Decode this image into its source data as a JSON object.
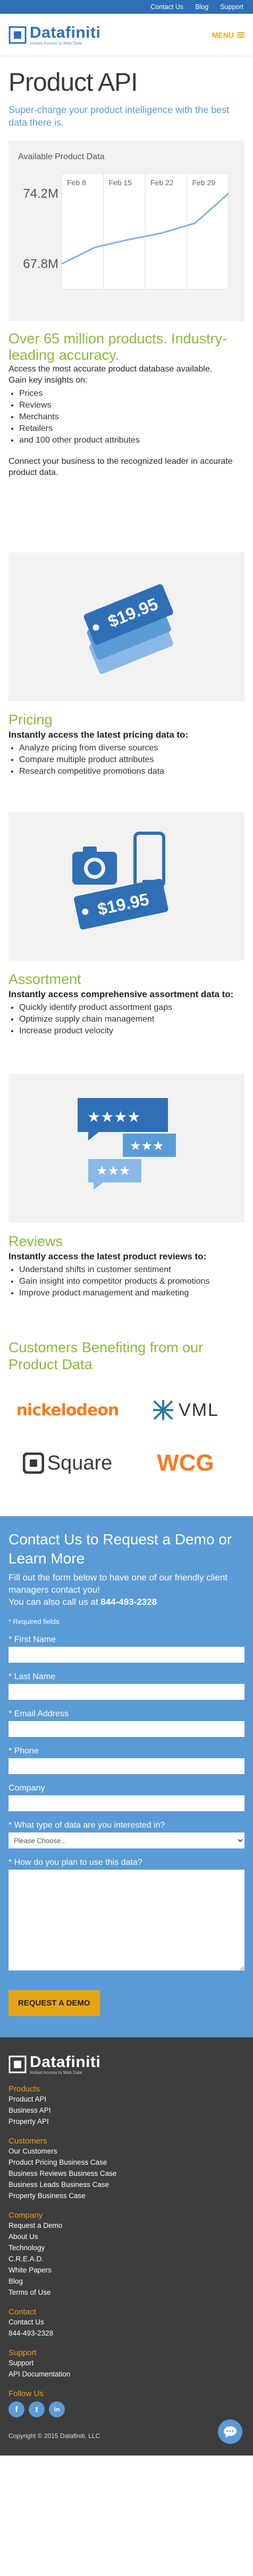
{
  "topnav": {
    "links": [
      "Contact Us",
      "Blog",
      "Support"
    ]
  },
  "header": {
    "logo_text": "Datafiniti",
    "logo_tag": "Instant Access to Web Data",
    "menu_label": "MENU"
  },
  "hero": {
    "title": "Product API",
    "subtitle": "Super-charge your product intelligence with the best data there is."
  },
  "chart_data": {
    "type": "line",
    "title": "Available Product Data",
    "categories": [
      "Feb 8",
      "Feb 15",
      "Feb 22",
      "Feb 29"
    ],
    "y_ticks": [
      "74.2M",
      "67.8M"
    ],
    "values": [
      67.8,
      69.3,
      70.0,
      70.6,
      71.5,
      74.2
    ],
    "ylim": [
      65.5,
      76.0
    ],
    "color": "#7fb1e3"
  },
  "intro": {
    "heading": "Over 65 million products. Industry-leading accuracy.",
    "lead": "Access the most accurate product database available.",
    "gain": "Gain key insights on:",
    "bullets": [
      "Prices",
      "Reviews",
      "Merchants",
      "Retailers",
      "and 100 other product attributes"
    ],
    "closing": "Connect your business to the recognized leader in accurate product data."
  },
  "pricing": {
    "heading": "Pricing",
    "sub": "Instantly access the latest pricing data to:",
    "bullets": [
      "Analyze pricing from diverse sources",
      "Compare multiple product attributes",
      "Research competitive promotions data"
    ],
    "tag_price": "$19.95"
  },
  "assortment": {
    "heading": "Assortment",
    "sub": "Instantly access comprehensive assortment data to:",
    "bullets": [
      "Quickly identify product assortment gaps",
      "Optimize supply chain management",
      "Increase product velocity"
    ],
    "tag_price": "$19.95"
  },
  "reviews": {
    "heading": "Reviews",
    "sub": "Instantly access the latest product reviews to:",
    "bullets": [
      "Understand shifts in customer sentiment",
      "Gain insight into competitor products & promotions",
      "Improve product management and marketing"
    ]
  },
  "customers": {
    "heading": "Customers Benefiting from our Product Data",
    "logos": [
      "nickelodeon",
      "VML",
      "Square",
      "WCG"
    ]
  },
  "contact": {
    "heading": "Contact Us to Request a Demo or Learn More",
    "text": "Fill out the form below to have one of our friendly client managers contact you!",
    "call_prefix": "You can also call us at",
    "phone": "844-493-2328",
    "required_note": "* Required fields",
    "fields": {
      "first_name": "* First Name",
      "last_name": "* Last Name",
      "email": "* Email Address",
      "phone": "* Phone",
      "company": "Company",
      "data_type": "* What type of data are you interested in?",
      "data_type_selected": "Please Choose...",
      "usage": "* How do you plan to use this data?"
    },
    "submit": "REQUEST A DEMO"
  },
  "footer": {
    "logo_text": "Datafiniti",
    "logo_tag": "Instant Access to Web Data",
    "products_h": "Products",
    "products": [
      "Product API",
      "Business API",
      "Property API"
    ],
    "customers_h": "Customers",
    "customers": [
      "Our Customers",
      "Product Pricing Business Case",
      "Business Reviews Business Case",
      "Business Leads Business Case",
      "Property Business Case"
    ],
    "company_h": "Company",
    "company": [
      "Request a Demo",
      "About Us",
      "Technology",
      "C.R.E.A.D.",
      "White Papers",
      "Blog",
      "Terms of Use"
    ],
    "contact_h": "Contact",
    "contact": [
      "Contact Us",
      "844-493-2328"
    ],
    "support_h": "Support",
    "support": [
      "Support",
      "API Documentation"
    ],
    "follow_h": "Follow Us",
    "social": [
      "f",
      "t",
      "in"
    ],
    "copyright": "Copyright © 2015 Datafiniti, LLC"
  }
}
